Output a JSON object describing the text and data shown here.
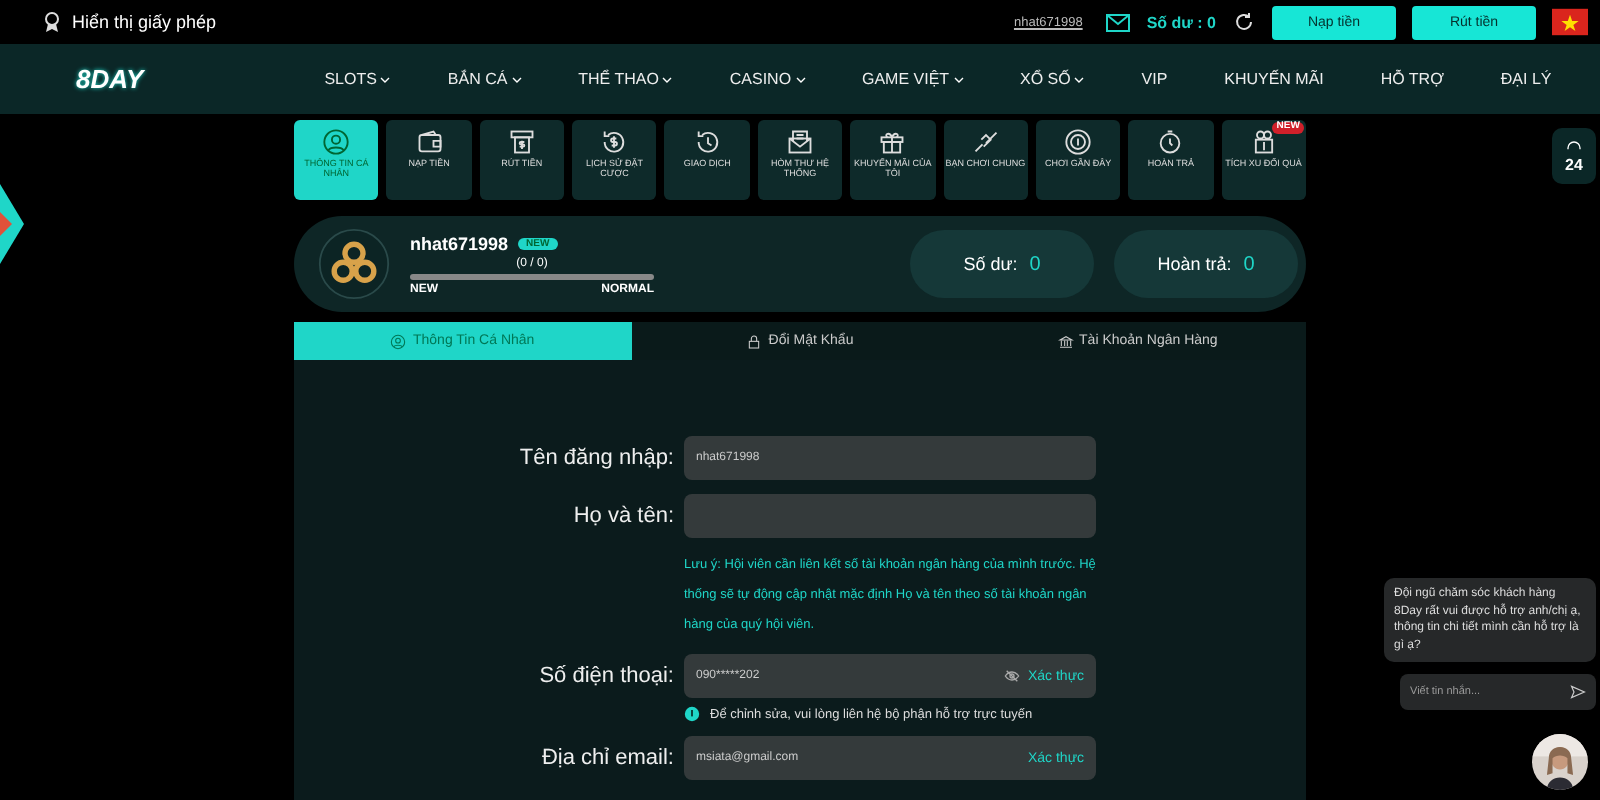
{
  "topbar": {
    "license": "Hiển thị giấy phép",
    "username": "nhat671998",
    "balance": "Số dư : 0",
    "buttons": [
      "Nạp tiền",
      "Rút tiền"
    ]
  },
  "logo": {
    "text": "8DAY"
  },
  "nav": [
    {
      "label": "SLOTS",
      "dropdown": true
    },
    {
      "label": "BẮN CÁ",
      "dropdown": true
    },
    {
      "label": "THỂ THAO",
      "dropdown": true
    },
    {
      "label": "CASINO",
      "dropdown": true
    },
    {
      "label": "GAME VIỆT",
      "dropdown": true
    },
    {
      "label": "XỔ SỐ",
      "dropdown": true
    },
    {
      "label": "VIP",
      "dropdown": false
    },
    {
      "label": "KHUYẾN MÃI",
      "dropdown": false
    },
    {
      "label": "HỖ TRỢ",
      "dropdown": false
    },
    {
      "label": "ĐẠI LÝ",
      "dropdown": false
    }
  ],
  "tiles": [
    {
      "kind": "user",
      "label": "THÔNG TIN CÁ NHÂN",
      "selected": true
    },
    {
      "kind": "wallet",
      "label": "NẠP TIỀN",
      "selected": false
    },
    {
      "kind": "atm",
      "label": "RÚT TIỀN",
      "selected": false
    },
    {
      "kind": "dollar",
      "label": "LỊCH SỬ ĐẶT CƯỢC",
      "selected": false
    },
    {
      "kind": "clock",
      "label": "GIAO DỊCH",
      "selected": false
    },
    {
      "kind": "mail",
      "label": "HÒM THƯ HỆ THỐNG",
      "selected": false
    },
    {
      "kind": "gift",
      "label": "KHUYẾN MÃI CỦA TÔI",
      "selected": false
    },
    {
      "kind": "hands",
      "label": "BẠN CHƠI CHUNG",
      "selected": false
    },
    {
      "kind": "chip",
      "label": "CHƠI GẦN ĐÂY",
      "selected": false
    },
    {
      "kind": "timer",
      "label": "HOÀN TRẢ",
      "selected": false
    },
    {
      "kind": "coins",
      "label": "TÍCH XU ĐỔI QUÀ",
      "selected": false,
      "badge": "NEW"
    }
  ],
  "profile": {
    "name": "nhat671998",
    "badge": "NEW",
    "progress_text": "(0 / 0)",
    "level": 0,
    "from": "NEW",
    "to": "NORMAL",
    "balance_label": "Số dư:",
    "balance": "0",
    "rebate_label": "Hoàn trả:",
    "rebate": "0"
  },
  "tabs": [
    {
      "kind": "user",
      "label": "Thông Tin Cá Nhân",
      "selected": true
    },
    {
      "kind": "lock",
      "label": "Đổi Mật Khẩu",
      "selected": false
    },
    {
      "kind": "bank",
      "label": "Tài Khoản Ngân Hàng",
      "selected": false
    }
  ],
  "form": [
    {
      "label": "Tên đăng nhập:",
      "value": "nhat671998"
    },
    {
      "label": "Họ và tên:",
      "note": "Lưu ý: Hội viên cần liên kết số tài khoản ngân hàng của mình trước. Hệ thống sẽ tự động cập nhật mặc định Họ và tên theo số tài khoản ngân hàng của quý hội viên."
    },
    {
      "label": "Số điện thoại:",
      "value": "090*****202",
      "hidden_icon": true,
      "action": "Xác thực",
      "info": "Để chỉnh sửa, vui lòng liên hệ bộ phận hỗ trợ trực tuyến"
    },
    {
      "label": "Địa chỉ email:",
      "value": "msiata@gmail.com",
      "action": "Xác thực"
    }
  ],
  "support": {
    "text": "24"
  },
  "chat": {
    "message": "Đội ngũ chăm sóc khách hàng 8Day rất vui được hỗ trợ anh/chị ạ, thông tin chi tiết mình cần hỗ trợ là gì ạ?",
    "placeholder": "Viết tin nhắn..."
  }
}
